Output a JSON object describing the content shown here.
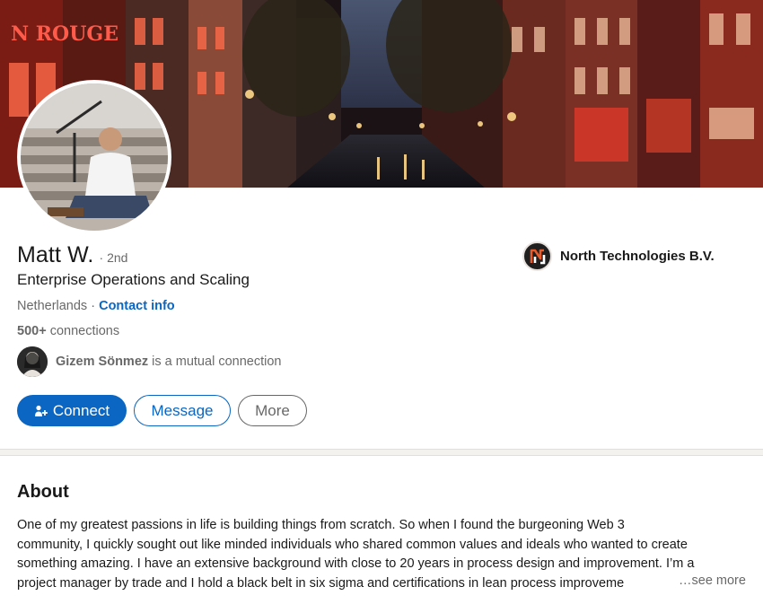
{
  "profile": {
    "name": "Matt W.",
    "degree_dot": "·",
    "degree": "2nd",
    "headline": "Enterprise Operations and Scaling",
    "location": "Netherlands",
    "separator": "·",
    "contact_info": "Contact info",
    "connections_count": "500+",
    "connections_label": "connections",
    "mutual_name": "Gizem Sönmez",
    "mutual_suffix": "is a mutual connection"
  },
  "company": {
    "name": "North Technologies B.V."
  },
  "actions": {
    "connect": "Connect",
    "message": "Message",
    "more": "More"
  },
  "about": {
    "title": "About",
    "lines": [
      "One of my greatest passions in life is building things from scratch. So when I found the burgeoning Web 3",
      "community, I quickly sought out like minded individuals who shared common values and ideals who wanted to create",
      "something amazing. I have an extensive background with close to 20 years in process design and improvement. I’m a",
      "project manager by trade and I hold a black belt in six sigma and certifications in lean process improveme"
    ],
    "see_more": "…see more"
  },
  "colors": {
    "brand_blue": "#0a66c2",
    "muted_text": "#666666"
  },
  "icons": {
    "connect": "add-person-icon",
    "company": "north-technologies-logo"
  }
}
